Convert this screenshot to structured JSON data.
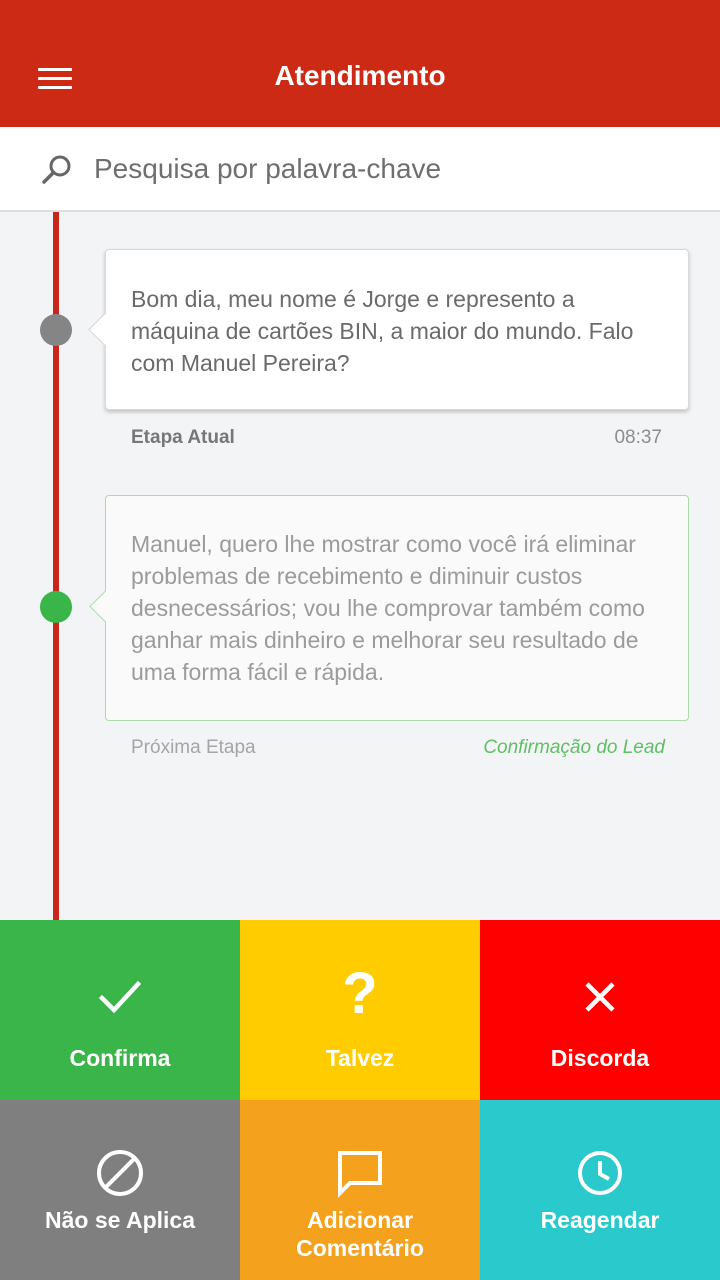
{
  "appbar": {
    "title": "Atendimento",
    "menu_icon": "hamburger-menu-icon"
  },
  "search": {
    "placeholder": "Pesquisa por palavra-chave",
    "icon": "search-icon"
  },
  "timeline": {
    "current": {
      "message": "Bom dia, meu nome é Jorge e represento a máquina de cartões BIN, a maior do mundo. Falo com Manuel Pereira?",
      "label": "Etapa Atual",
      "time": "08:37"
    },
    "next": {
      "message": "Manuel, quero lhe mostrar como você irá eliminar problemas de recebimento e diminuir custos desnecessários; vou lhe comprovar também como ganhar mais dinheiro e melhorar seu resultado de uma forma fácil e rápida.",
      "label": "Próxima Etapa",
      "link": "Confirmação do Lead"
    }
  },
  "actions": {
    "confirma": {
      "label": "Confirma",
      "icon": "check-icon",
      "color": "#3ab54a"
    },
    "talvez": {
      "label": "Talvez",
      "icon": "question-icon",
      "glyph": "?",
      "color": "#ffcc00"
    },
    "discorda": {
      "label": "Discorda",
      "icon": "close-icon",
      "color": "#fe0000"
    },
    "nao_aplica": {
      "label": "Não se Aplica",
      "icon": "block-icon",
      "color": "#7f7f7f"
    },
    "comentario": {
      "label_line1": "Adicionar",
      "label_line2": "Comentário",
      "icon": "comment-icon",
      "color": "#f4a11e"
    },
    "reagendar": {
      "label": "Reagendar",
      "icon": "clock-icon",
      "color": "#29c9cc"
    }
  },
  "colors": {
    "primary": "#cc2a14",
    "timeline": "#c8261a",
    "dot_current": "#858585",
    "dot_next": "#3ab54a"
  }
}
